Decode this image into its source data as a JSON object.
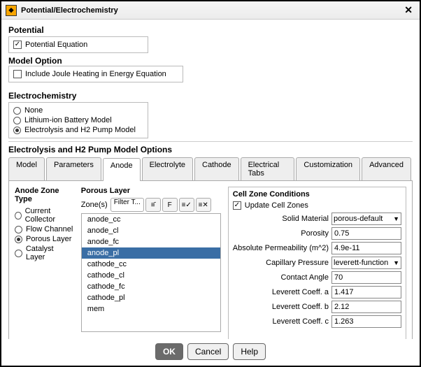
{
  "window": {
    "title": "Potential/Electrochemistry"
  },
  "potential": {
    "heading": "Potential",
    "equation_label": "Potential Equation",
    "equation_checked": true,
    "model_option_heading": "Model Option",
    "joule_label": "Include Joule Heating in Energy Equation",
    "joule_checked": false
  },
  "electrochem": {
    "heading": "Electrochemistry",
    "options": [
      {
        "label": "None",
        "selected": false
      },
      {
        "label": "Lithium-ion Battery Model",
        "selected": false
      },
      {
        "label": "Electrolysis and H2 Pump Model",
        "selected": true
      }
    ]
  },
  "options_panel": {
    "heading": "Electrolysis and H2 Pump Model Options",
    "tabs": [
      "Model",
      "Parameters",
      "Anode",
      "Electrolyte",
      "Cathode",
      "Electrical Tabs",
      "Customization",
      "Advanced"
    ],
    "active_tab": "Anode"
  },
  "anode_zone_type": {
    "heading": "Anode Zone Type",
    "options": [
      {
        "label": "Current Collector",
        "selected": false
      },
      {
        "label": "Flow Channel",
        "selected": false
      },
      {
        "label": "Porous Layer",
        "selected": true
      },
      {
        "label": "Catalyst Layer",
        "selected": false
      }
    ]
  },
  "porous_layer": {
    "heading": "Porous Layer",
    "zones_label": "Zone(s)",
    "filter_label": "Filter T...",
    "icons": [
      "filter-equals-icon",
      "filter-contains-icon",
      "filter-match-icon",
      "filter-clear-icon"
    ],
    "items": [
      "anode_cc",
      "anode_cl",
      "anode_fc",
      "anode_pl",
      "cathode_cc",
      "cathode_cl",
      "cathode_fc",
      "cathode_pl",
      "mem"
    ],
    "selected": "anode_pl"
  },
  "cell_zone": {
    "heading": "Cell Zone Conditions",
    "update_label": "Update Cell Zones",
    "update_checked": true,
    "fields": {
      "solid_material": {
        "label": "Solid Material",
        "value": "porous-default",
        "type": "select"
      },
      "porosity": {
        "label": "Porosity",
        "value": "0.75",
        "type": "text"
      },
      "abs_perm": {
        "label": "Absolute Permeability (m^2)",
        "value": "4.9e-11",
        "type": "text"
      },
      "cap_press": {
        "label": "Capillary Pressure",
        "value": "leverett-function",
        "type": "select"
      },
      "contact_angle": {
        "label": "Contact Angle",
        "value": "70",
        "type": "text"
      },
      "lev_a": {
        "label": "Leverett Coeff. a",
        "value": "1.417",
        "type": "text"
      },
      "lev_b": {
        "label": "Leverett Coeff. b",
        "value": "2.12",
        "type": "text"
      },
      "lev_c": {
        "label": "Leverett Coeff. c",
        "value": "1.263",
        "type": "text"
      }
    }
  },
  "footer": {
    "ok": "OK",
    "cancel": "Cancel",
    "help": "Help"
  }
}
